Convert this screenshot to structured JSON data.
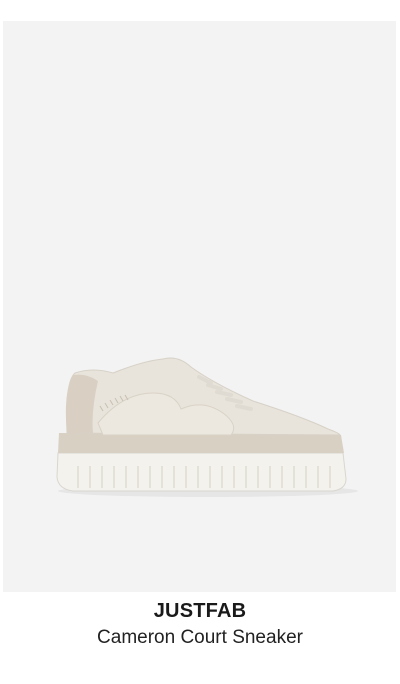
{
  "product": {
    "brand": "JUSTFAB",
    "name": "Cameron Court Sneaker",
    "image_alt": "sneaker-product-image",
    "colors": {
      "image_background": "#f3f3f3",
      "upper": "#e7e2da",
      "accent": "#cfc6b8",
      "sole": "#f4f2ec"
    }
  }
}
